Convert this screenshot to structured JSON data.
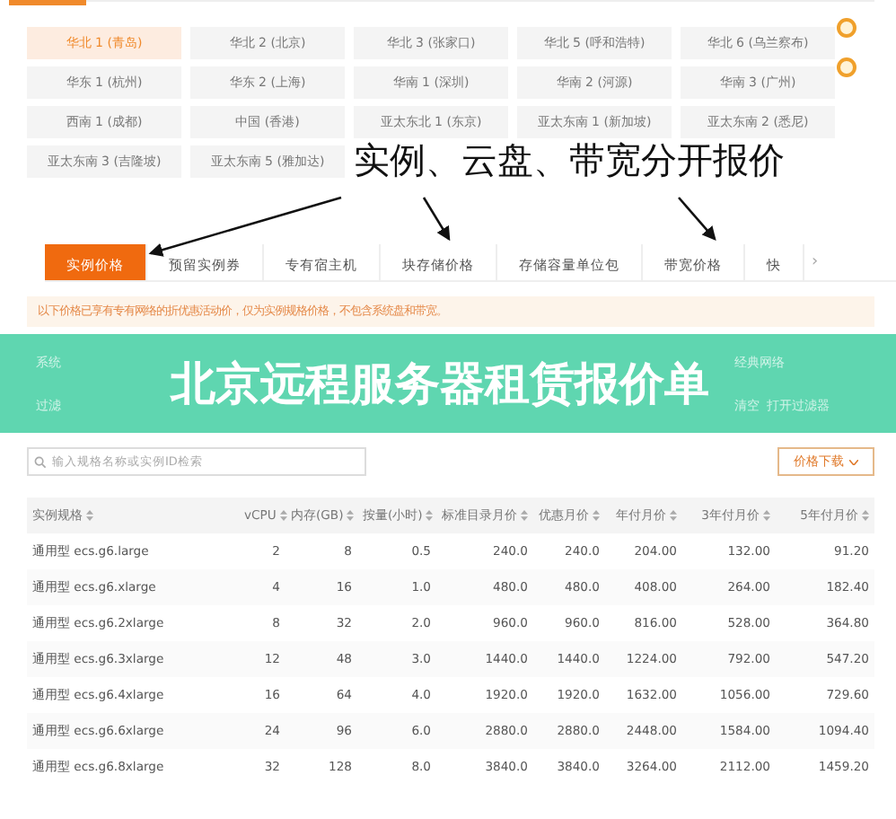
{
  "regions": [
    {
      "label": "华北 1 (青岛)",
      "selected": true,
      "new": false
    },
    {
      "label": "华北 2 (北京)",
      "selected": false,
      "new": false
    },
    {
      "label": "华北 3 (张家口)",
      "selected": false,
      "new": false
    },
    {
      "label": "华北 5 (呼和浩特)",
      "selected": false,
      "new": false
    },
    {
      "label": "华北 6 (乌兰察布)",
      "selected": false,
      "new": true
    },
    {
      "label": "华东 1 (杭州)",
      "selected": false,
      "new": false
    },
    {
      "label": "华东 2 (上海)",
      "selected": false,
      "new": false
    },
    {
      "label": "华南 1 (深圳)",
      "selected": false,
      "new": false
    },
    {
      "label": "华南 2 (河源)",
      "selected": false,
      "new": false
    },
    {
      "label": "华南 3 (广州)",
      "selected": false,
      "new": true
    },
    {
      "label": "西南 1 (成都)",
      "selected": false,
      "new": false
    },
    {
      "label": "中国 (香港)",
      "selected": false,
      "new": false
    },
    {
      "label": "亚太东北 1 (东京)",
      "selected": false,
      "new": false
    },
    {
      "label": "亚太东南 1 (新加坡)",
      "selected": false,
      "new": false
    },
    {
      "label": "亚太东南 2 (悉尼)",
      "selected": false,
      "new": false
    },
    {
      "label": "亚太东南 3 (吉隆坡)",
      "selected": false,
      "new": false
    },
    {
      "label": "亚太东南 5 (雅加达)",
      "selected": false,
      "new": false
    }
  ],
  "annotation": "实例、云盘、带宽分开报价",
  "tabs": [
    {
      "label": "实例价格",
      "selected": true
    },
    {
      "label": "预留实例券",
      "selected": false
    },
    {
      "label": "专有宿主机",
      "selected": false
    },
    {
      "label": "块存储价格",
      "selected": false
    },
    {
      "label": "存储容量单位包",
      "selected": false
    },
    {
      "label": "带宽价格",
      "selected": false
    },
    {
      "label": "快",
      "selected": false
    }
  ],
  "tabs_more": "›",
  "notice": "以下价格已享有专有网络的折优惠活动价，仅为实例规格价格，不包含系统盘和带宽。",
  "banner": {
    "title": "北京远程服务器租赁报价单",
    "filter_labels": [
      "系统",
      "过滤"
    ],
    "network": "经典网络",
    "clear": "清空",
    "open_filter": "打开过滤器"
  },
  "search": {
    "placeholder": "输入规格名称或实例ID检索"
  },
  "download": "价格下载",
  "table": {
    "columns": [
      "实例规格",
      "vCPU",
      "内存(GB)",
      "按量(小时)",
      "标准目录月价",
      "优惠月价",
      "年付月价",
      "3年付月价",
      "5年付月价"
    ],
    "rows": [
      [
        "通用型 ecs.g6.large",
        "2",
        "8",
        "0.5",
        "240.0",
        "240.0",
        "204.00",
        "132.00",
        "91.20"
      ],
      [
        "通用型 ecs.g6.xlarge",
        "4",
        "16",
        "1.0",
        "480.0",
        "480.0",
        "408.00",
        "264.00",
        "182.40"
      ],
      [
        "通用型 ecs.g6.2xlarge",
        "8",
        "32",
        "2.0",
        "960.0",
        "960.0",
        "816.00",
        "528.00",
        "364.80"
      ],
      [
        "通用型 ecs.g6.3xlarge",
        "12",
        "48",
        "3.0",
        "1440.0",
        "1440.0",
        "1224.00",
        "792.00",
        "547.20"
      ],
      [
        "通用型 ecs.g6.4xlarge",
        "16",
        "64",
        "4.0",
        "1920.0",
        "1920.0",
        "1632.00",
        "1056.00",
        "729.60"
      ],
      [
        "通用型 ecs.g6.6xlarge",
        "24",
        "96",
        "6.0",
        "2880.0",
        "2880.0",
        "2448.00",
        "1584.00",
        "1094.40"
      ],
      [
        "通用型 ecs.g6.8xlarge",
        "32",
        "128",
        "8.0",
        "3840.0",
        "3840.0",
        "3264.00",
        "2112.00",
        "1459.20"
      ]
    ]
  }
}
